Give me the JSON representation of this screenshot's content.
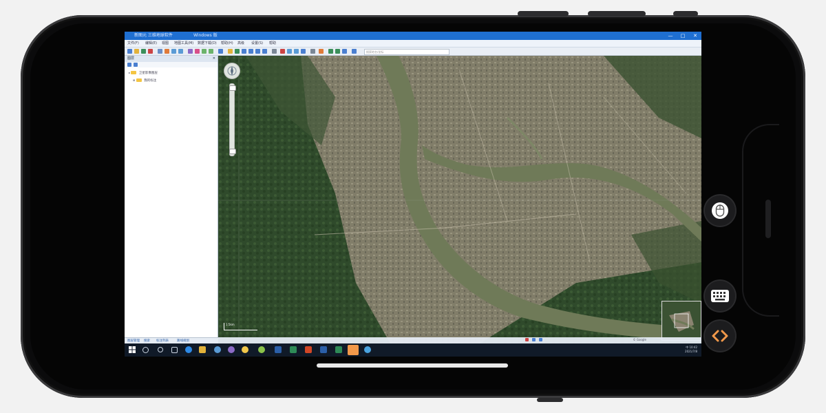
{
  "window": {
    "title": "新图元 三维地球软件",
    "subtitle": "Windows 版",
    "controls": [
      "—",
      "□",
      "✕"
    ]
  },
  "menu": {
    "items": [
      "文件(F)",
      "编辑(E)",
      "视图",
      "地图工具(M)",
      "数据下载(D)",
      "帮助(H)",
      "高级",
      "设置(S)",
      "帮助"
    ]
  },
  "toolbar": {
    "search_placeholder": "搜索地名/坐标"
  },
  "panel": {
    "title": "图层",
    "tree": [
      {
        "label": "卫星影像图层"
      },
      {
        "label": "我的标注"
      }
    ],
    "tabs": [
      "图层管理",
      "搜索",
      "标注列表",
      "路线规划"
    ]
  },
  "map": {
    "scale_label": "1:5km",
    "attribution": "© Google"
  },
  "taskbar": {
    "time": "10:42",
    "date": "2021/7/8",
    "tray_text": "中"
  },
  "floating": {
    "mouse_button": "mouse-icon",
    "keyboard_button": "keyboard-icon",
    "code_button": "code-icon",
    "code_color": "#f2994a"
  }
}
